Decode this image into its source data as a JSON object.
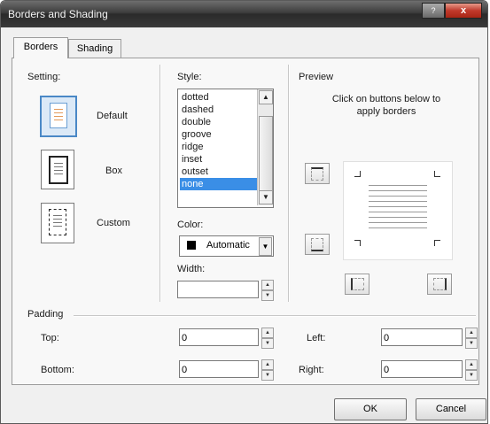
{
  "window": {
    "title": "Borders and Shading",
    "close_glyph": "x",
    "help_glyph": "?"
  },
  "tabs": [
    {
      "label": "Borders"
    },
    {
      "label": "Shading"
    }
  ],
  "setting": {
    "label": "Setting:",
    "options": [
      {
        "label": "Default"
      },
      {
        "label": "Box"
      },
      {
        "label": "Custom"
      }
    ],
    "selected": "Default"
  },
  "style": {
    "label": "Style:",
    "items": [
      "dotted",
      "dashed",
      "double",
      "groove",
      "ridge",
      "inset",
      "outset",
      "none"
    ],
    "selected": "none"
  },
  "color": {
    "label": "Color:",
    "value": "Automatic",
    "swatch": "#000000"
  },
  "width": {
    "label": "Width:",
    "value": ""
  },
  "preview": {
    "label": "Preview",
    "hint": "Click on buttons below to apply borders"
  },
  "padding": {
    "label": "Padding",
    "top_label": "Top:",
    "top_value": "0",
    "bottom_label": "Bottom:",
    "bottom_value": "0",
    "left_label": "Left:",
    "left_value": "0",
    "right_label": "Right:",
    "right_value": "0"
  },
  "buttons": {
    "ok": "OK",
    "cancel": "Cancel"
  },
  "colors": {
    "accent": "#3a8ee6",
    "title_bar": "#3c3c3c"
  }
}
